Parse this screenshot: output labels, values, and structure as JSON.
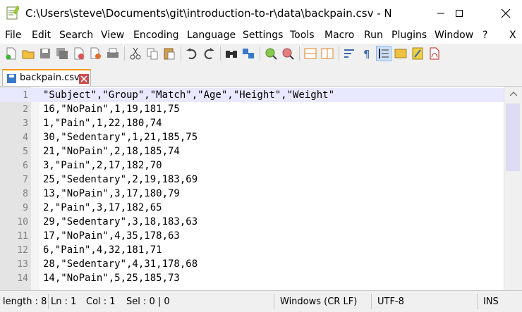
{
  "window": {
    "title": "C:\\Users\\steve\\Documents\\git\\introduction-to-r\\data\\backpain.csv - Notepad++"
  },
  "menu": {
    "items": [
      "File",
      "Edit",
      "Search",
      "View",
      "Encoding",
      "Language",
      "Settings",
      "Tools",
      "Macro",
      "Run",
      "Plugins",
      "Window",
      "?"
    ],
    "close_label": "X"
  },
  "toolbar": {
    "icons": [
      "new-file-icon",
      "open-file-icon",
      "save-icon",
      "save-all-icon",
      "close-icon",
      "close-all-icon",
      "print-icon",
      "cut-icon",
      "copy-icon",
      "paste-icon",
      "undo-icon",
      "redo-icon",
      "find-icon",
      "replace-icon",
      "zoom-in-icon",
      "zoom-out-icon",
      "sync-vertical-icon",
      "sync-horizontal-icon",
      "word-wrap-icon",
      "show-all-characters-icon",
      "indent-guide-icon",
      "document-map-icon",
      "macro-record-icon",
      "pdf-icon"
    ]
  },
  "tab": {
    "label": "backpain.csv"
  },
  "editor": {
    "current_line": 1,
    "lines": [
      "\"Subject\",\"Group\",\"Match\",\"Age\",\"Height\",\"Weight\"",
      "16,\"NoPain\",1,19,181,75",
      "1,\"Pain\",1,22,180,74",
      "30,\"Sedentary\",1,21,185,75",
      "21,\"NoPain\",2,18,185,74",
      "3,\"Pain\",2,17,182,70",
      "25,\"Sedentary\",2,19,183,69",
      "13,\"NoPain\",3,17,180,79",
      "2,\"Pain\",3,17,182,65",
      "29,\"Sedentary\",3,18,183,63",
      "17,\"NoPain\",4,35,178,63",
      "6,\"Pain\",4,32,181,71",
      "28,\"Sedentary\",4,31,178,68",
      "14,\"NoPain\",5,25,185,73"
    ]
  },
  "status": {
    "length": "length : 8",
    "line": "Ln : 1",
    "col": "Col : 1",
    "sel": "Sel : 0 | 0",
    "eol": "Windows (CR LF)",
    "encoding": "UTF-8",
    "mode": "INS"
  },
  "colors": {
    "tab_accent": "#fa9600",
    "current_line": "#e8e8ff",
    "gutter": "#e4e4e4"
  }
}
